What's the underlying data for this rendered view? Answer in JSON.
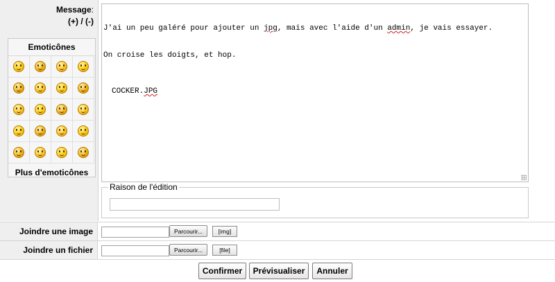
{
  "message": {
    "label": "Message",
    "colon": ":",
    "resize": "(+) / (-)",
    "lines": [
      [
        "J'ai un peu galéré pour ajouter un ",
        "jpg",
        ", mais avec l'aide d'un ",
        "admin",
        ", je vais essayer."
      ],
      [
        "On croise les doigts, et hop."
      ]
    ],
    "attachment_prefix": "COCKER.",
    "attachment_ext": "JPG"
  },
  "emoticons": {
    "title": "Emoticônes",
    "more": "Plus d'emoticônes",
    "icons": [
      "cool-smiley",
      "confused-smiley",
      "smile-smiley",
      "grin-smiley",
      "happy-smiley",
      "wink-smiley",
      "tongue-smiley",
      "angry-smiley",
      "mad-smiley",
      "shocked-smiley",
      "question-smiley",
      "dizzy-smiley",
      "laugh-smiley",
      "sleepy-smiley",
      "rolling-eyes-smiley",
      "surprised-smiley",
      "blush-smiley",
      "scream-smiley",
      "neutral-smiley",
      "crazy-smiley"
    ]
  },
  "edit_reason": {
    "legend": "Raison de l'édition",
    "value": ""
  },
  "attach_image": {
    "label": "Joindre une image",
    "browse": "Parcourir...",
    "tag": "[img]"
  },
  "attach_file": {
    "label": "Joindre un fichier",
    "browse": "Parcourir...",
    "tag": "[file]"
  },
  "actions": {
    "confirm": "Confirmer",
    "preview": "Prévisualiser",
    "cancel": "Annuler"
  }
}
